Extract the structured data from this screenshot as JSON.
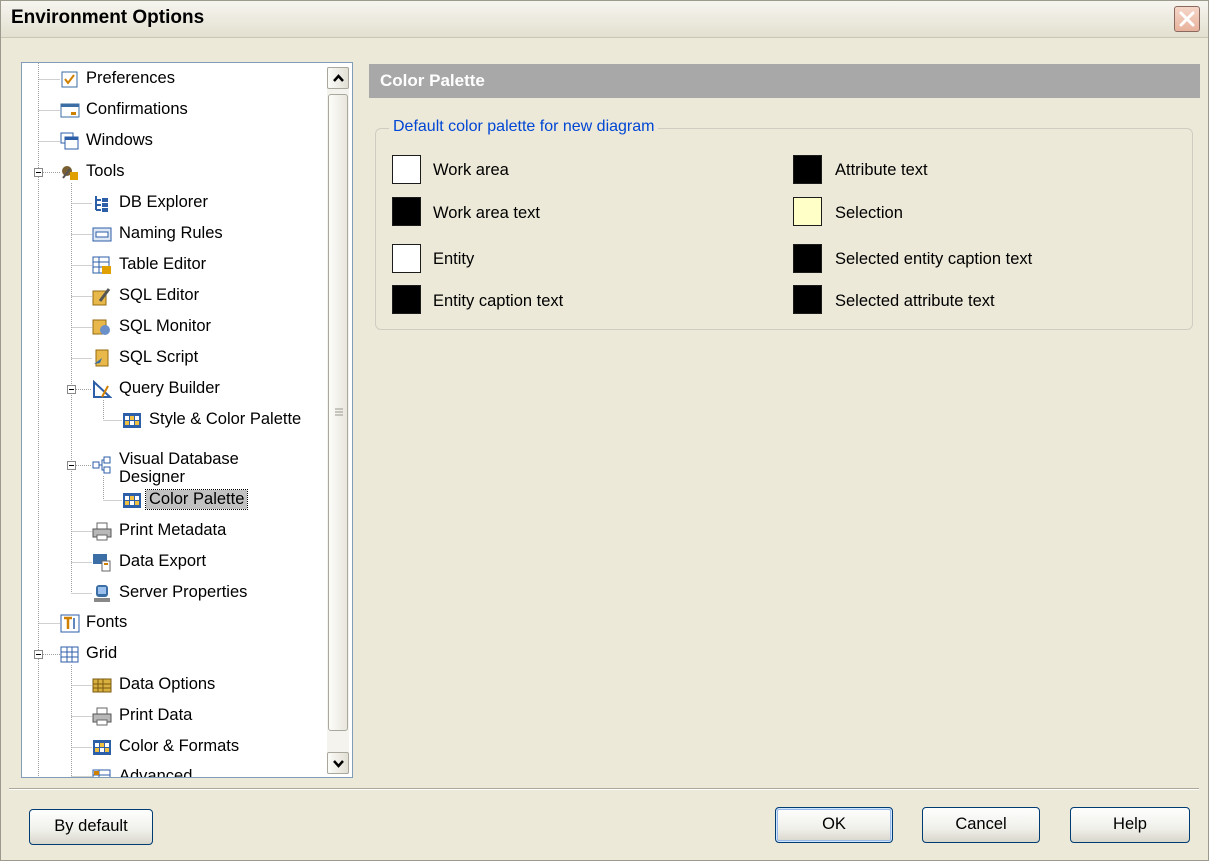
{
  "window": {
    "title": "Environment Options"
  },
  "tree": {
    "items": [
      {
        "label": "Preferences",
        "icon": "checkbox-icon"
      },
      {
        "label": "Confirmations",
        "icon": "dialog-icon"
      },
      {
        "label": "Windows",
        "icon": "windows-icon"
      },
      {
        "label": "Tools",
        "icon": "tools-icon"
      },
      {
        "label": "DB Explorer",
        "icon": "db-explorer-icon"
      },
      {
        "label": "Naming Rules",
        "icon": "naming-rules-icon"
      },
      {
        "label": "Table Editor",
        "icon": "table-editor-icon"
      },
      {
        "label": "SQL Editor",
        "icon": "sql-editor-icon"
      },
      {
        "label": "SQL Monitor",
        "icon": "sql-monitor-icon"
      },
      {
        "label": "SQL Script",
        "icon": "sql-script-icon"
      },
      {
        "label": "Query Builder",
        "icon": "query-builder-icon"
      },
      {
        "label": "Style & Color Palette",
        "icon": "palette-icon"
      },
      {
        "label": "Visual Database Designer",
        "icon": "designer-icon"
      },
      {
        "label": "Color Palette",
        "icon": "palette-icon"
      },
      {
        "label": "Print Metadata",
        "icon": "printer-icon"
      },
      {
        "label": "Data Export",
        "icon": "data-export-icon"
      },
      {
        "label": "Server Properties",
        "icon": "server-icon"
      },
      {
        "label": "Fonts",
        "icon": "fonts-icon"
      },
      {
        "label": "Grid",
        "icon": "grid-icon"
      },
      {
        "label": "Data Options",
        "icon": "data-options-icon"
      },
      {
        "label": "Print Data",
        "icon": "printer-icon"
      },
      {
        "label": "Color & Formats",
        "icon": "palette-icon"
      },
      {
        "label": "Advanced",
        "icon": "advanced-icon"
      }
    ],
    "selected": "Color Palette"
  },
  "panel": {
    "title": "Color Palette",
    "group_title": "Default color palette for new diagram",
    "colors": [
      {
        "label": "Work area",
        "color": "#ffffff"
      },
      {
        "label": "Work area text",
        "color": "#000000"
      },
      {
        "label": "Entity",
        "color": "#ffffff"
      },
      {
        "label": "Entity caption text",
        "color": "#000000"
      },
      {
        "label": "Attribute text",
        "color": "#000000"
      },
      {
        "label": "Selection",
        "color": "#ffffc8"
      },
      {
        "label": "Selected entity caption text",
        "color": "#000000"
      },
      {
        "label": "Selected attribute text",
        "color": "#000000"
      }
    ]
  },
  "buttons": {
    "by_default": "By default",
    "ok": "OK",
    "cancel": "Cancel",
    "help": "Help"
  }
}
